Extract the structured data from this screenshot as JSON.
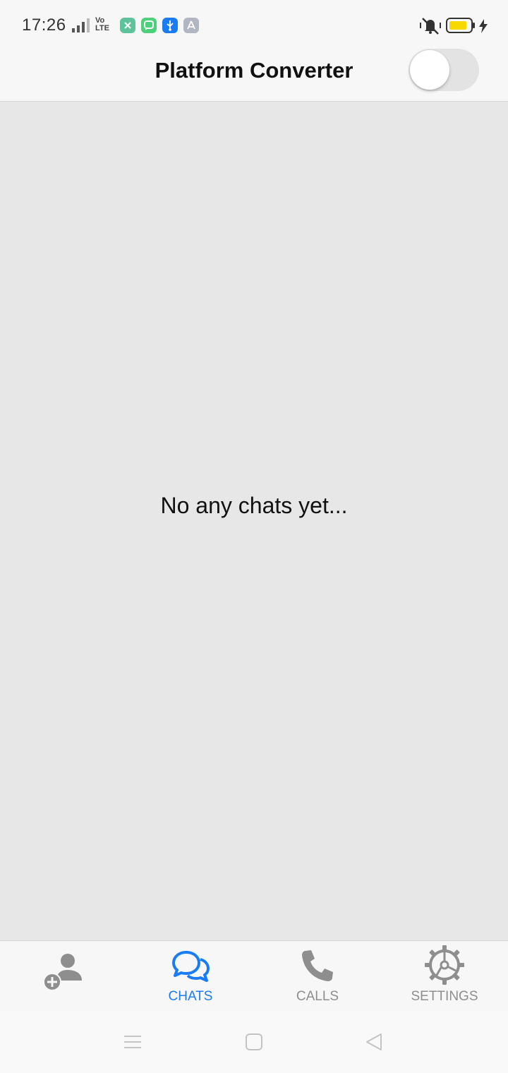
{
  "status_bar": {
    "time": "17:26",
    "network_label_top": "Vo",
    "network_label_bottom": "LTE",
    "icons": [
      "signal-icon",
      "app-notification-icon",
      "message-notification-icon",
      "usb-icon",
      "app-store-icon",
      "mute-icon",
      "battery-icon",
      "charging-icon"
    ],
    "colors": {
      "notif_green": "#5ec39a",
      "message_green": "#4cd17a",
      "usb_blue": "#1a7cf5",
      "gray": "#b0b6c2",
      "battery": "#f7d800"
    }
  },
  "header": {
    "title": "Platform Converter",
    "toggle_on": false
  },
  "main": {
    "empty_message": "No any chats yet..."
  },
  "tabs": [
    {
      "id": "add-contact",
      "label": "",
      "icon": "add-contact-icon",
      "active": false
    },
    {
      "id": "chats",
      "label": "CHATS",
      "icon": "chat-bubbles-icon",
      "active": true
    },
    {
      "id": "calls",
      "label": "CALLS",
      "icon": "phone-icon",
      "active": false
    },
    {
      "id": "settings",
      "label": "SETTINGS",
      "icon": "gear-icon",
      "active": false
    }
  ],
  "theme": {
    "accent": "#1a7cf5",
    "inactive": "#8e8e8e",
    "background": "#e7e7e7"
  },
  "nav_bar": {
    "buttons": [
      "menu-icon",
      "home-icon",
      "back-icon"
    ]
  }
}
